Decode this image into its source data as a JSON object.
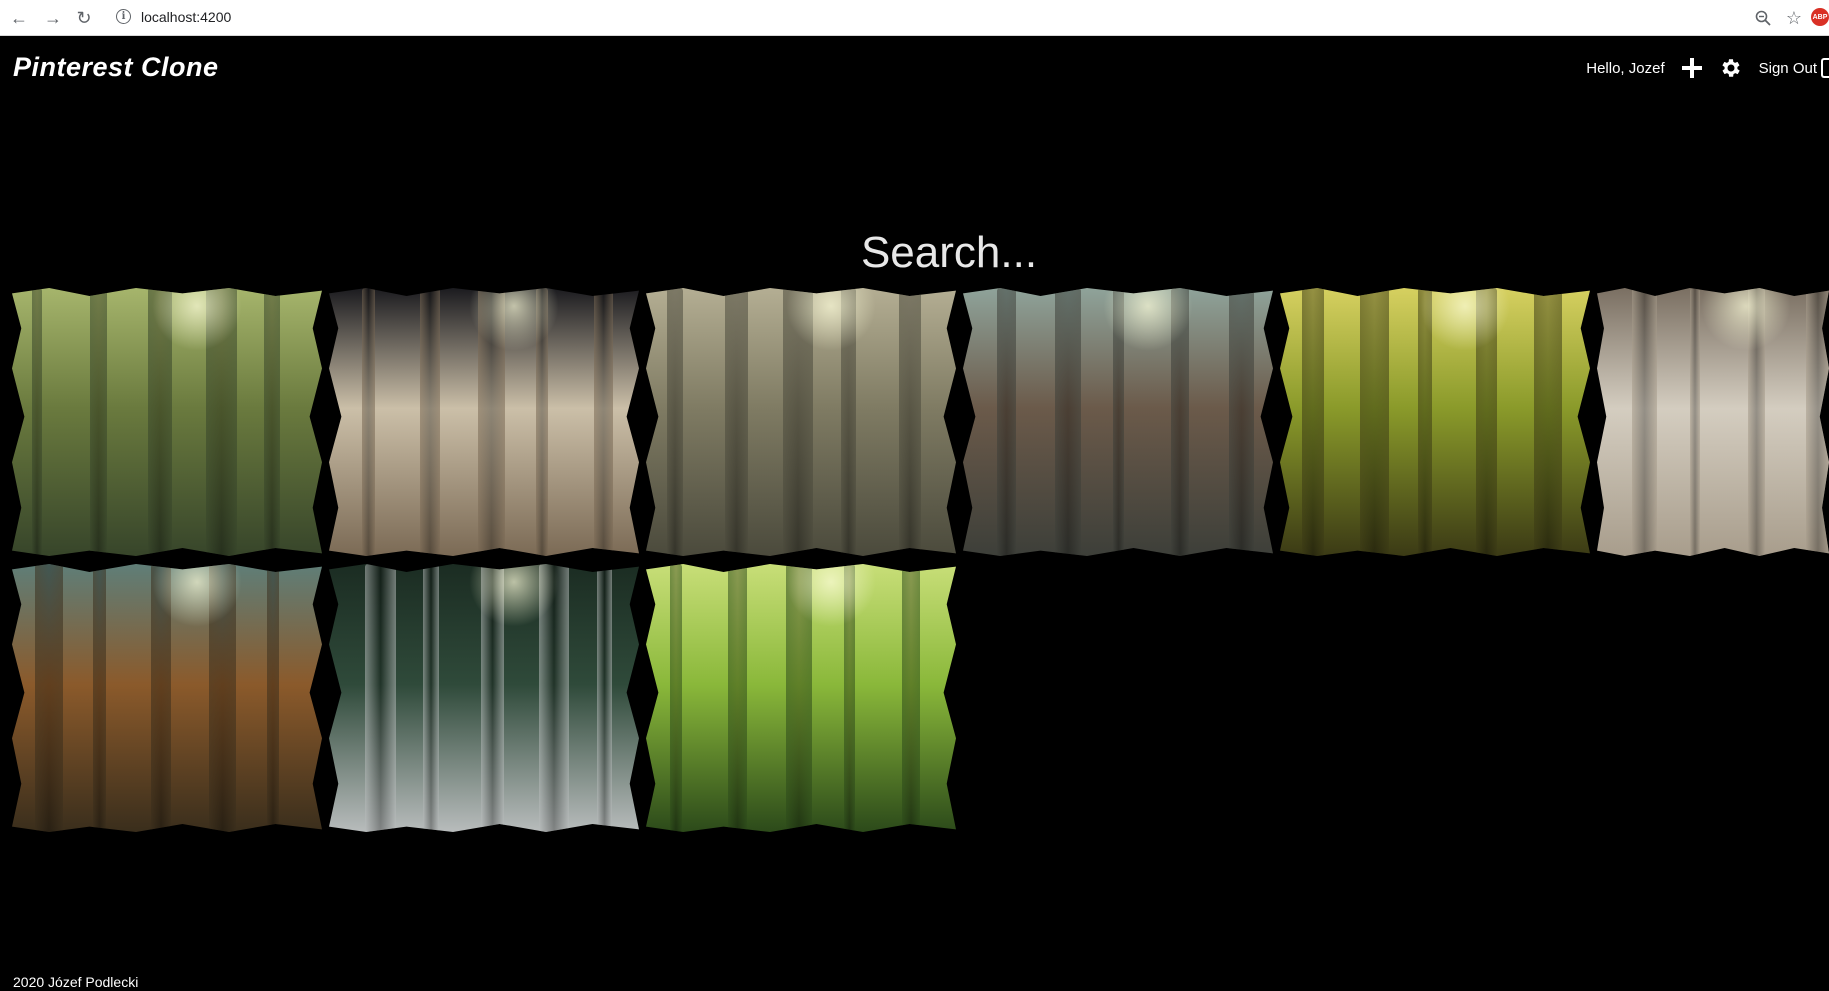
{
  "browser": {
    "url": "localhost:4200",
    "icons": [
      "back-arrow-icon",
      "forward-arrow-icon",
      "reload-icon",
      "info-icon",
      "zoom-icon",
      "star-icon",
      "adblock-icon"
    ],
    "adblock_label": "ABP"
  },
  "header": {
    "brand": "Pinterest Clone",
    "greeting": "Hello, Jozef",
    "signout_label": "Sign Out",
    "icons": [
      "plus-icon",
      "gear-icon",
      "sign-out-icon"
    ]
  },
  "search": {
    "text": "Search..."
  },
  "gallery": {
    "tiles": [
      {
        "name": "forest-moss",
        "colors": [
          "#37452a",
          "#6a7a3e",
          "#a6b56c"
        ]
      },
      {
        "name": "black-panther-tree",
        "colors": [
          "#7b6a55",
          "#cbbfa8",
          "#1b1b1f"
        ]
      },
      {
        "name": "misty-forest-path",
        "colors": [
          "#4b4a3c",
          "#7f7b63",
          "#b4ae93"
        ]
      },
      {
        "name": "redwood-forest",
        "colors": [
          "#3d3f39",
          "#6b5a4a",
          "#8fa39a"
        ]
      },
      {
        "name": "sunlit-green-forest",
        "colors": [
          "#3b3a15",
          "#8a9a2a",
          "#d6d060"
        ]
      },
      {
        "name": "gallery-wall-room",
        "colors": [
          "#a89d8c",
          "#d4cdc0",
          "#7a6f62"
        ]
      },
      {
        "name": "autumn-stream-forest",
        "colors": [
          "#3a2e1c",
          "#8b5a2b",
          "#5f7e78"
        ]
      },
      {
        "name": "foggy-pine-forest",
        "colors": [
          "#b8bcbc",
          "#2f4a3a",
          "#1b2c22"
        ]
      },
      {
        "name": "bright-green-woods",
        "colors": [
          "#2c4a1a",
          "#8ab83a",
          "#c8de78"
        ]
      }
    ]
  },
  "footer": {
    "text": "2020 Józef Podlecki"
  }
}
